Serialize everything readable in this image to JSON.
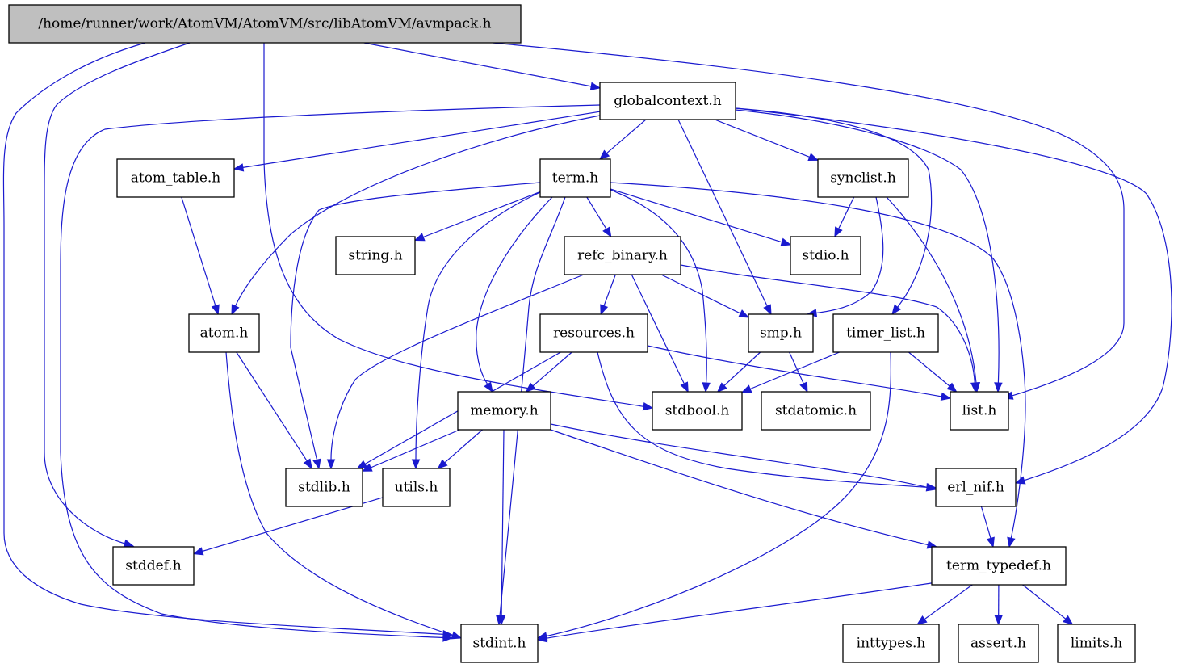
{
  "graph": {
    "type": "include-dependency-graph",
    "root": "avmpack",
    "colors": {
      "edge": "#1a1acf",
      "root_fill": "#bfbfbf",
      "node_fill": "#ffffff",
      "node_border": "#000000"
    },
    "nodes": [
      {
        "id": "avmpack",
        "label": "/home/runner/work/AtomVM/AtomVM/src/libAtomVM/avmpack.h"
      },
      {
        "id": "globalcontext",
        "label": "globalcontext.h"
      },
      {
        "id": "atom_table",
        "label": "atom_table.h"
      },
      {
        "id": "term",
        "label": "term.h"
      },
      {
        "id": "synclist",
        "label": "synclist.h"
      },
      {
        "id": "string",
        "label": "string.h"
      },
      {
        "id": "refc_binary",
        "label": "refc_binary.h"
      },
      {
        "id": "stdio",
        "label": "stdio.h"
      },
      {
        "id": "atom",
        "label": "atom.h"
      },
      {
        "id": "resources",
        "label": "resources.h"
      },
      {
        "id": "smp",
        "label": "smp.h"
      },
      {
        "id": "timer_list",
        "label": "timer_list.h"
      },
      {
        "id": "memory",
        "label": "memory.h"
      },
      {
        "id": "stdbool",
        "label": "stdbool.h"
      },
      {
        "id": "stdatomic",
        "label": "stdatomic.h"
      },
      {
        "id": "list",
        "label": "list.h"
      },
      {
        "id": "stdlib",
        "label": "stdlib.h"
      },
      {
        "id": "utils",
        "label": "utils.h"
      },
      {
        "id": "erl_nif",
        "label": "erl_nif.h"
      },
      {
        "id": "stddef",
        "label": "stddef.h"
      },
      {
        "id": "term_typedef",
        "label": "term_typedef.h"
      },
      {
        "id": "stdint",
        "label": "stdint.h"
      },
      {
        "id": "inttypes",
        "label": "inttypes.h"
      },
      {
        "id": "assert",
        "label": "assert.h"
      },
      {
        "id": "limits",
        "label": "limits.h"
      }
    ],
    "edges": [
      [
        "avmpack",
        "globalcontext"
      ],
      [
        "avmpack",
        "stdbool"
      ],
      [
        "avmpack",
        "stddef"
      ],
      [
        "avmpack",
        "stdint"
      ],
      [
        "avmpack",
        "list"
      ],
      [
        "globalcontext",
        "atom_table"
      ],
      [
        "globalcontext",
        "term"
      ],
      [
        "globalcontext",
        "synclist"
      ],
      [
        "globalcontext",
        "atom"
      ],
      [
        "globalcontext",
        "smp"
      ],
      [
        "globalcontext",
        "timer_list"
      ],
      [
        "globalcontext",
        "list"
      ],
      [
        "globalcontext",
        "erl_nif"
      ],
      [
        "globalcontext",
        "stdint"
      ],
      [
        "atom_table",
        "atom"
      ],
      [
        "term",
        "string"
      ],
      [
        "term",
        "refc_binary"
      ],
      [
        "term",
        "stdio"
      ],
      [
        "term",
        "stdlib"
      ],
      [
        "term",
        "utils"
      ],
      [
        "term",
        "memory"
      ],
      [
        "term",
        "stdbool"
      ],
      [
        "term",
        "stdint"
      ],
      [
        "term",
        "term_typedef"
      ],
      [
        "synclist",
        "stdio"
      ],
      [
        "synclist",
        "smp"
      ],
      [
        "synclist",
        "list"
      ],
      [
        "refc_binary",
        "resources"
      ],
      [
        "refc_binary",
        "smp"
      ],
      [
        "refc_binary",
        "stdbool"
      ],
      [
        "refc_binary",
        "stdlib"
      ],
      [
        "refc_binary",
        "list"
      ],
      [
        "atom",
        "stdlib"
      ],
      [
        "atom",
        "stdint"
      ],
      [
        "resources",
        "memory"
      ],
      [
        "resources",
        "stdlib"
      ],
      [
        "resources",
        "list"
      ],
      [
        "resources",
        "erl_nif"
      ],
      [
        "smp",
        "stdbool"
      ],
      [
        "smp",
        "stdatomic"
      ],
      [
        "timer_list",
        "stdbool"
      ],
      [
        "timer_list",
        "list"
      ],
      [
        "timer_list",
        "stdint"
      ],
      [
        "memory",
        "stdlib"
      ],
      [
        "memory",
        "utils"
      ],
      [
        "memory",
        "stdint"
      ],
      [
        "memory",
        "erl_nif"
      ],
      [
        "memory",
        "term_typedef"
      ],
      [
        "utils",
        "stddef"
      ],
      [
        "erl_nif",
        "term_typedef"
      ],
      [
        "term_typedef",
        "stdint"
      ],
      [
        "term_typedef",
        "inttypes"
      ],
      [
        "term_typedef",
        "assert"
      ],
      [
        "term_typedef",
        "limits"
      ]
    ]
  }
}
